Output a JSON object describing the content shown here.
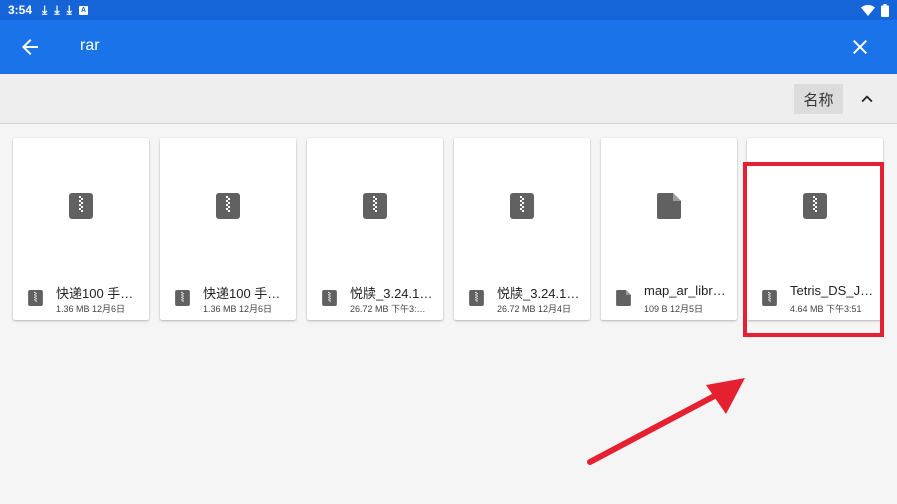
{
  "status_bar": {
    "time": "3:54",
    "notification_icons": [
      "download-icon",
      "download-icon",
      "download-icon",
      "app-notification-icon"
    ],
    "right_icons": [
      "wifi-icon",
      "battery-icon"
    ]
  },
  "app_bar": {
    "search_query": "rar",
    "back_icon": "arrow-back-icon",
    "close_icon": "close-icon",
    "background": "#1a73e8"
  },
  "sort_bar": {
    "sort_label": "名称",
    "direction_icon": "chevron-up-icon"
  },
  "files": [
    {
      "name": "快递100 手…",
      "size": "1.36 MB",
      "date": "12月6日",
      "type": "archive"
    },
    {
      "name": "快递100 手…",
      "size": "1.36 MB",
      "date": "12月6日",
      "type": "archive"
    },
    {
      "name": "悦牍_3.24.1…",
      "size": "26.72 MB",
      "date": "下午3:…",
      "type": "archive"
    },
    {
      "name": "悦牍_3.24.1…",
      "size": "26.72 MB",
      "date": "12月4日",
      "type": "archive"
    },
    {
      "name": "map_ar_libr…",
      "size": "109 B",
      "date": "12月5日",
      "type": "file"
    },
    {
      "name": "Tetris_DS_J…",
      "size": "4.64 MB",
      "date": "下午3:51",
      "type": "archive"
    }
  ],
  "annotation": {
    "highlight_color": "#e52030",
    "highlighted_item": "Tetris_DS_J…"
  },
  "detail_lines": [
    "1.36 MB 12月6日",
    "1.36 MB 12月6日",
    "26.72 MB 下午3:…",
    "26.72 MB 12月4日",
    "109 B 12月5日",
    "4.64 MB 下午3:51"
  ]
}
